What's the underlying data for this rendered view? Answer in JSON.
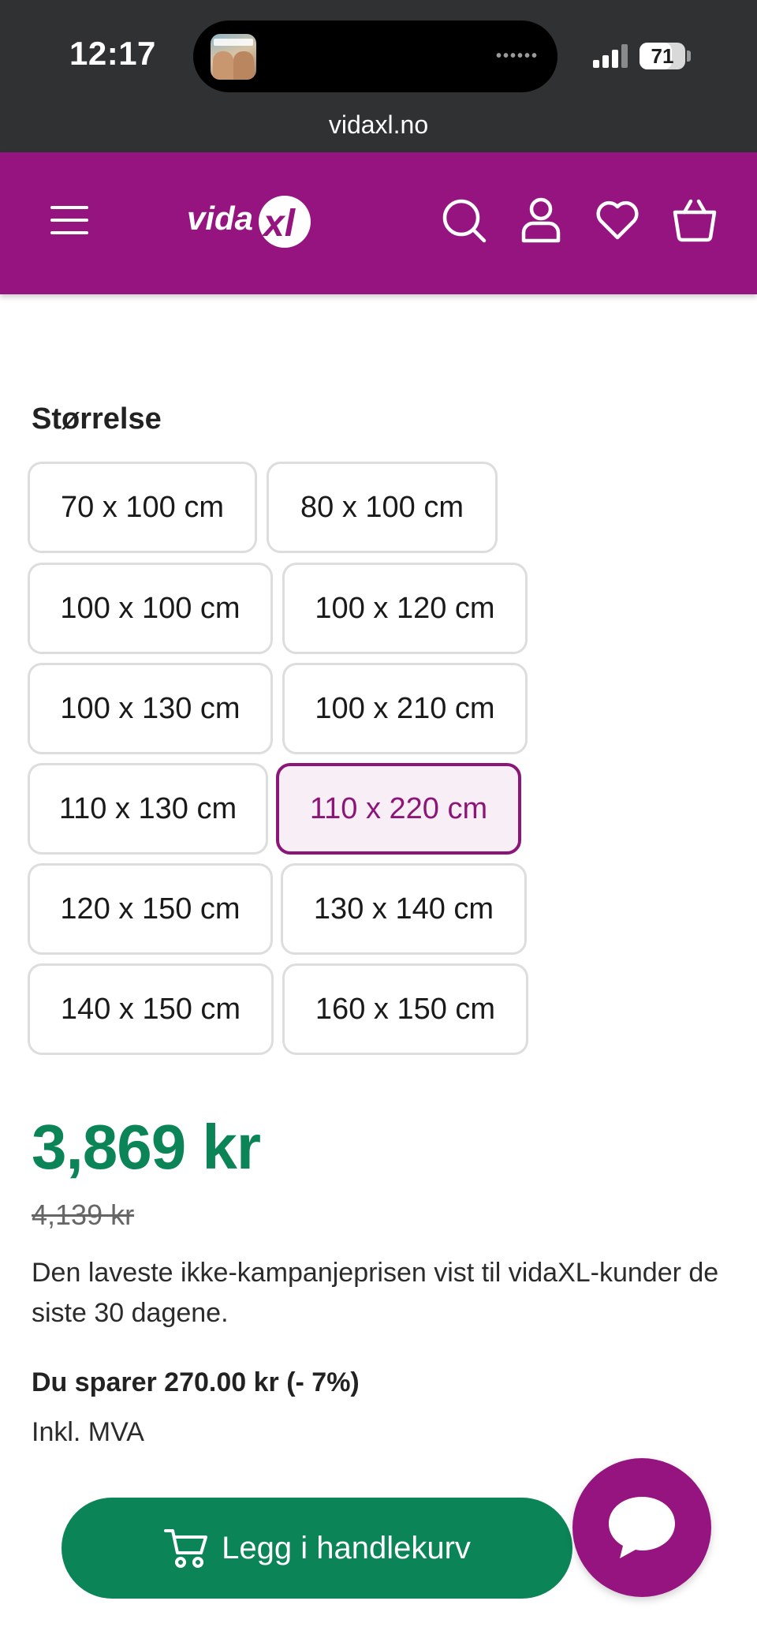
{
  "status_bar": {
    "time": "12:17",
    "battery": "71",
    "battery_level": 0.71,
    "signal_bars": 4
  },
  "browser": {
    "url": "vidaxl.no"
  },
  "header": {
    "logo": "vidaXL",
    "brand_color": "#96147f",
    "icons": [
      "menu-icon",
      "search-icon",
      "account-icon",
      "heart-icon",
      "basket-icon"
    ]
  },
  "size": {
    "title": "Størrelse",
    "options": [
      "70 x 100 cm",
      "80 x 100 cm",
      "100 x 100 cm",
      "100 x 120 cm",
      "100 x 130 cm",
      "100 x 210 cm",
      "110 x 130 cm",
      "110 x 220 cm",
      "120 x 150 cm",
      "130 x 140 cm",
      "140 x 150 cm",
      "160 x 150 cm"
    ],
    "selected": "110 x 220 cm"
  },
  "pricing": {
    "price": "3,869 kr",
    "old_price": "4,139 kr",
    "note": "Den laveste ikke-kampanjeprisen vist til vidaXL-kunder de siste 30 dagene.",
    "savings": "Du sparer 270.00 kr (- 7%)",
    "vat": "Inkl. MVA",
    "price_color": "#0b8457"
  },
  "actions": {
    "add_to_cart": "Legg i handlekurv",
    "chat_icon": "chat-bubble-icon"
  }
}
